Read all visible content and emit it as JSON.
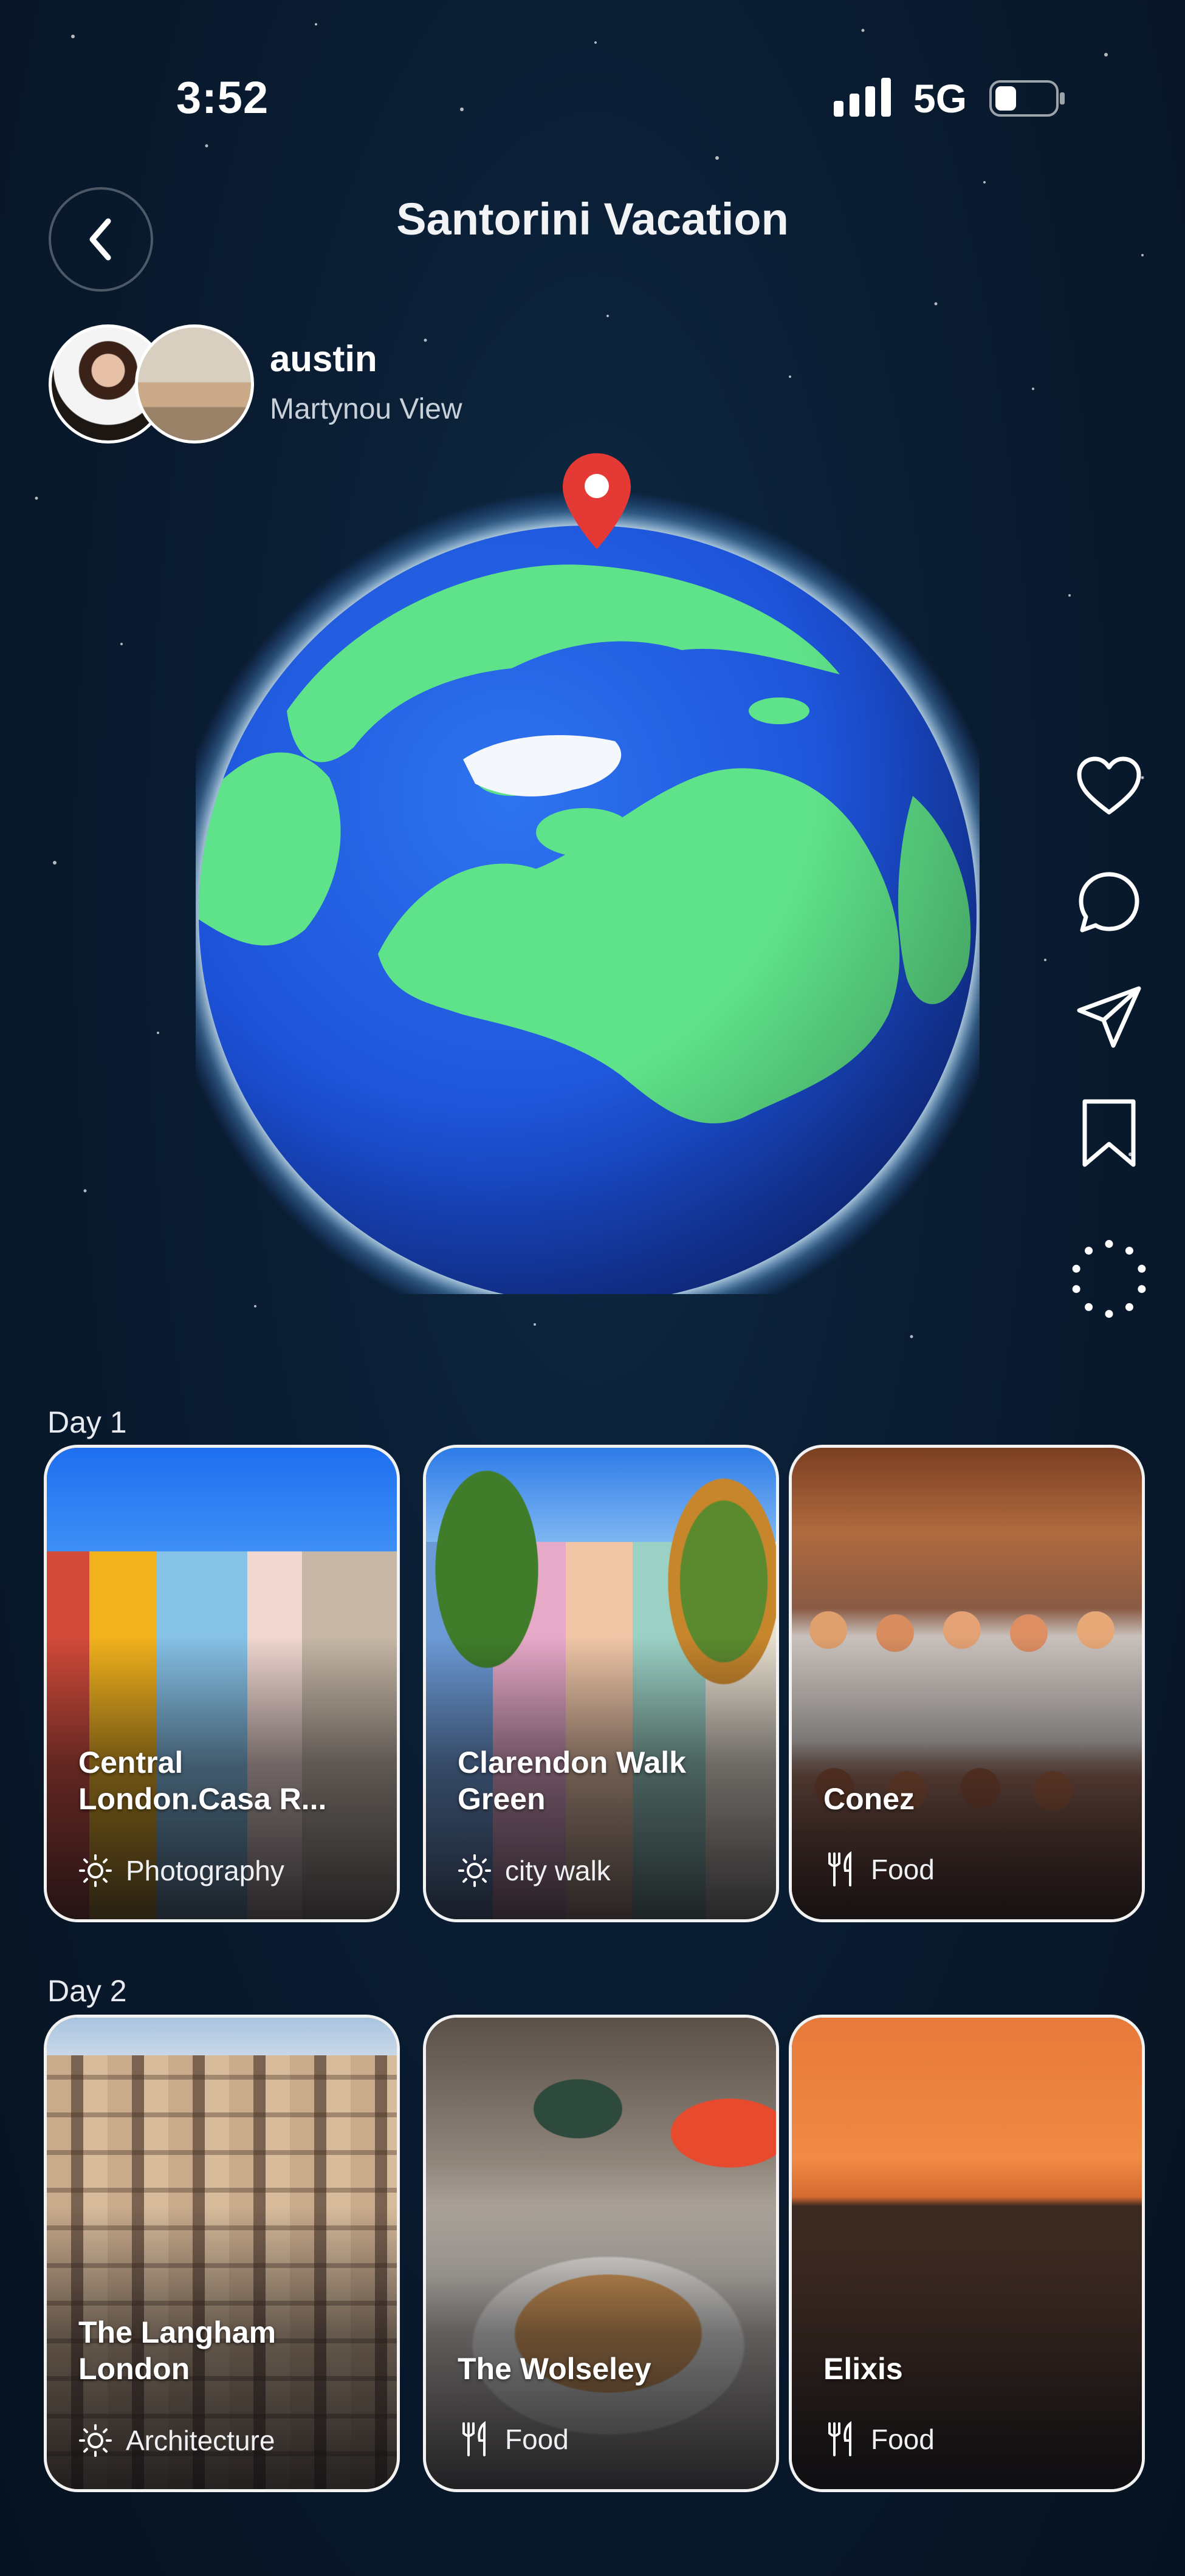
{
  "status_bar": {
    "time": "3:52",
    "network": "5G"
  },
  "header": {
    "title": "Santorini Vacation"
  },
  "user": {
    "name": "austin",
    "subtitle": "Martynou View"
  },
  "globe": {
    "pin_color": "#e53935",
    "land_color": "#5fe38a",
    "ocean_color": "#1f5fe0"
  },
  "actions": [
    "heart-icon",
    "comment-icon",
    "send-icon",
    "bookmark-icon",
    "more-dots-icon"
  ],
  "days": [
    {
      "label": "Day 1",
      "places": [
        {
          "name": "Central London.Casa R...",
          "category": "Photography",
          "icon": "sun-icon"
        },
        {
          "name": "Clarendon Walk Green",
          "category": "city walk",
          "icon": "sun-icon"
        },
        {
          "name": "Conez",
          "category": "Food",
          "icon": "fork-knife-icon"
        }
      ]
    },
    {
      "label": "Day 2",
      "places": [
        {
          "name": "The Langham London",
          "category": "Architecture",
          "icon": "sun-icon"
        },
        {
          "name": "The Wolseley",
          "category": "Food",
          "icon": "fork-knife-icon"
        },
        {
          "name": "Elixis",
          "category": "Food",
          "icon": "fork-knife-icon"
        }
      ]
    }
  ]
}
